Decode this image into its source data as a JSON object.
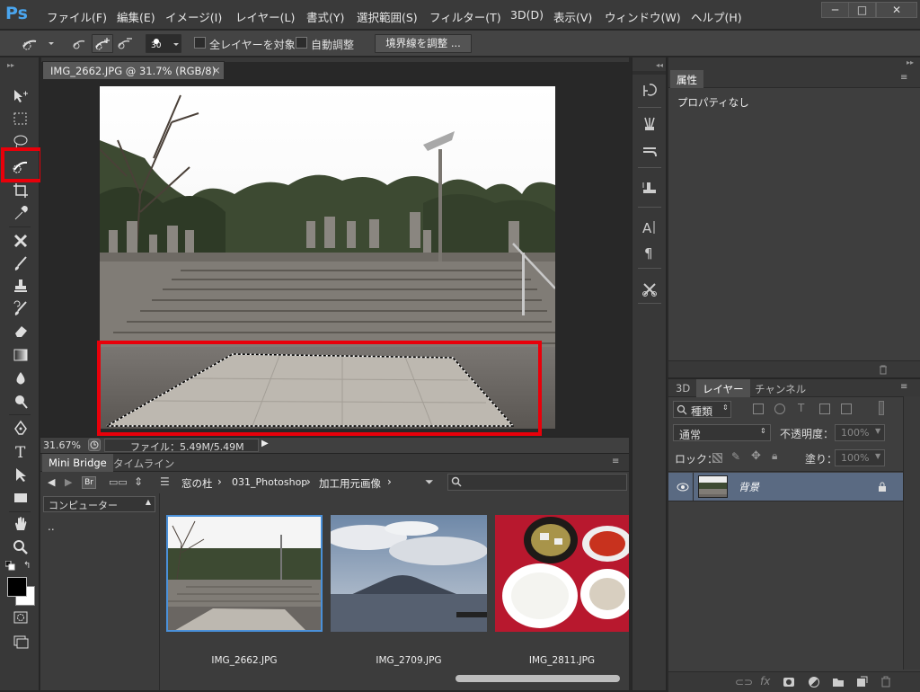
{
  "menubar": {
    "logo": "Ps",
    "items": [
      "ファイル(F)",
      "編集(E)",
      "イメージ(I)",
      "レイヤー(L)",
      "書式(Y)",
      "選択範囲(S)",
      "フィルター(T)",
      "3D(D)",
      "表示(V)",
      "ウィンドウ(W)",
      "ヘルプ(H)"
    ],
    "win_minimize": "─",
    "win_maximize": "□",
    "win_close": "✕"
  },
  "options": {
    "brush_size": "30",
    "sample_all_layers": "全レイヤーを対象",
    "auto_enhance": "自動調整",
    "refine_edge": "境界線を調整 ..."
  },
  "document": {
    "tab_title": "IMG_2662.JPG @ 31.7% (RGB/8)",
    "tab_close": "×",
    "zoom": "31.67%",
    "file_info": "ファイル：5.49M/5.49M"
  },
  "bottom_panel": {
    "tabs": [
      "Mini Bridge",
      "タイムライン"
    ],
    "br_label": "Br",
    "breadcrumb": [
      "窓の杜",
      "031_Photoshop",
      "加工用元画像"
    ],
    "location_dropdown": "コンピューター",
    "tree_item": "..",
    "thumbnails": [
      {
        "name": "IMG_2662.JPG"
      },
      {
        "name": "IMG_2709.JPG"
      },
      {
        "name": "IMG_2811.JPG"
      }
    ]
  },
  "properties_panel": {
    "tab": "属性",
    "content": "プロパティなし"
  },
  "layers_panel": {
    "tabs": [
      "3D",
      "レイヤー",
      "チャンネル"
    ],
    "filter_kind": "種類",
    "blend_mode": "通常",
    "opacity_label": "不透明度：",
    "opacity_value": "100%",
    "lock_label": "ロック：",
    "fill_label": "塗り：",
    "fill_value": "100%",
    "layer_name": "背景"
  },
  "tools": {
    "fg_color": "#000000",
    "bg_color": "#ffffff"
  },
  "colors": {
    "highlight_red": "#e8000a",
    "selection_blue": "#4a90d9"
  }
}
